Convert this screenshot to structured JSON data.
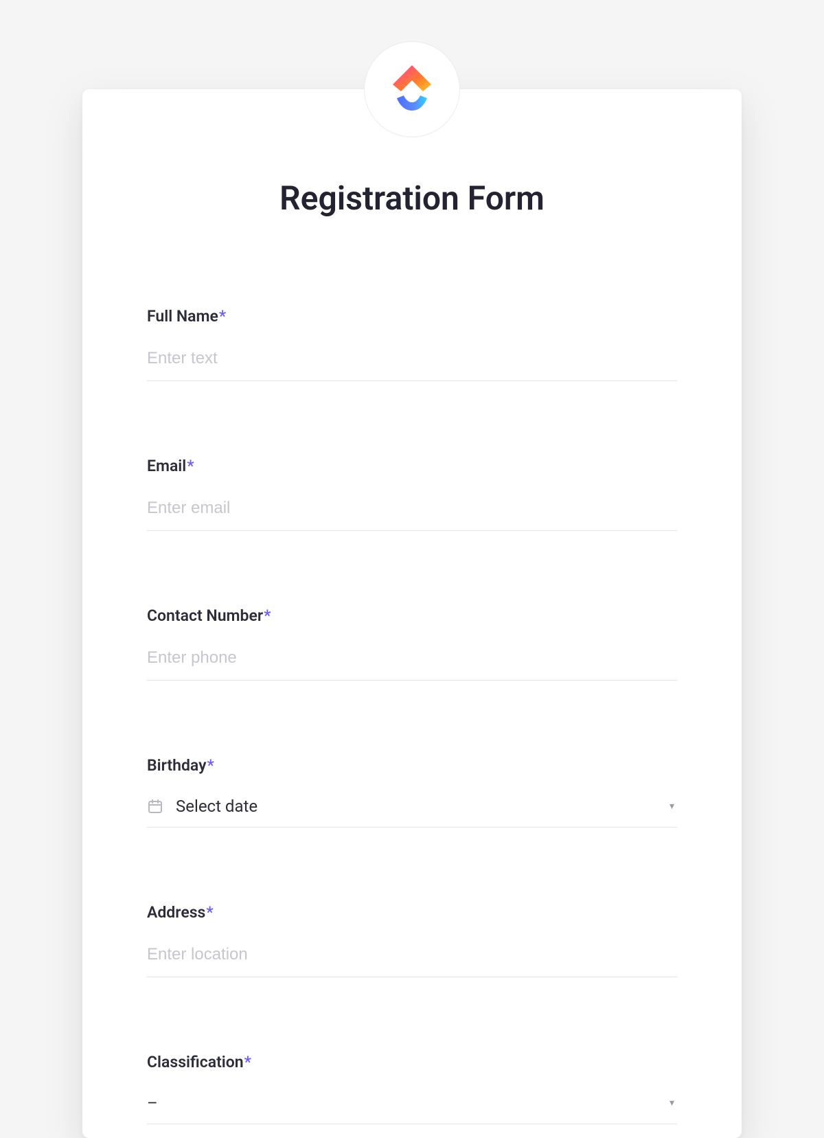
{
  "form": {
    "title": "Registration Form",
    "required_marker": "*",
    "fields": {
      "full_name": {
        "label": "Full Name",
        "placeholder": "Enter text"
      },
      "email": {
        "label": "Email",
        "placeholder": "Enter email"
      },
      "contact_number": {
        "label": "Contact Number",
        "placeholder": "Enter phone"
      },
      "birthday": {
        "label": "Birthday",
        "placeholder": "Select date"
      },
      "address": {
        "label": "Address",
        "placeholder": "Enter location"
      },
      "classification": {
        "label": "Classification",
        "placeholder": "–"
      }
    }
  }
}
